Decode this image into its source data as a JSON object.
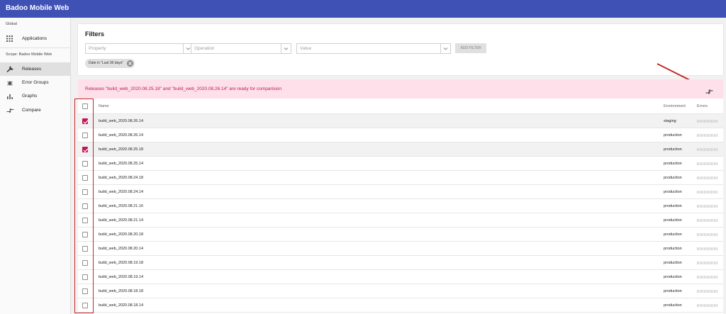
{
  "app": {
    "title": "Badoo Mobile Web"
  },
  "sidebar": {
    "global_label": "Global",
    "applications_label": "Applications",
    "scope_label": "Scope: Badoo Mobile Web",
    "items": [
      {
        "label": "Releases",
        "icon": "wrench-icon",
        "active": true
      },
      {
        "label": "Error Groups",
        "icon": "bug-icon",
        "active": false
      },
      {
        "label": "Graphs",
        "icon": "bar-chart-icon",
        "active": false
      },
      {
        "label": "Compare",
        "icon": "compare-arrows-icon",
        "active": false
      }
    ]
  },
  "filters": {
    "title": "Filters",
    "property_placeholder": "Property",
    "operation_placeholder": "Operation",
    "value_placeholder": "Value",
    "add_filter_label": "ADD FILTER",
    "chip_label": "Date in \"Last 30 days\""
  },
  "banner": {
    "message": "Releases \"build_web_2020.08.25.18\" and \"build_web_2020.08.26.14\" are ready for comparision",
    "accent_color": "#c2185b",
    "background": "#fde0e9"
  },
  "table": {
    "columns": {
      "name": "Name",
      "environment": "Environment",
      "errors": "Errors"
    },
    "rows": [
      {
        "name": "build_web_2020.08.26.14",
        "environment": "staging",
        "checked": true
      },
      {
        "name": "build_web_2020.08.26.14",
        "environment": "production",
        "checked": false
      },
      {
        "name": "build_web_2020.08.25.18",
        "environment": "production",
        "checked": true
      },
      {
        "name": "build_web_2020.08.25.14",
        "environment": "production",
        "checked": false
      },
      {
        "name": "build_web_2020.08.24.18",
        "environment": "production",
        "checked": false
      },
      {
        "name": "build_web_2020.08.24.14",
        "environment": "production",
        "checked": false
      },
      {
        "name": "build_web_2020.08.21.16",
        "environment": "production",
        "checked": false
      },
      {
        "name": "build_web_2020.08.21.14",
        "environment": "production",
        "checked": false
      },
      {
        "name": "build_web_2020.08.20.18",
        "environment": "production",
        "checked": false
      },
      {
        "name": "build_web_2020.08.20.14",
        "environment": "production",
        "checked": false
      },
      {
        "name": "build_web_2020.08.19.18",
        "environment": "production",
        "checked": false
      },
      {
        "name": "build_web_2020.08.19.14",
        "environment": "production",
        "checked": false
      },
      {
        "name": "build_web_2020.08.18.18",
        "environment": "production",
        "checked": false
      },
      {
        "name": "build_web_2020.08.18.14",
        "environment": "production",
        "checked": false
      }
    ]
  },
  "colors": {
    "appbar": "#3f51b5",
    "annotation": "#c62828"
  }
}
